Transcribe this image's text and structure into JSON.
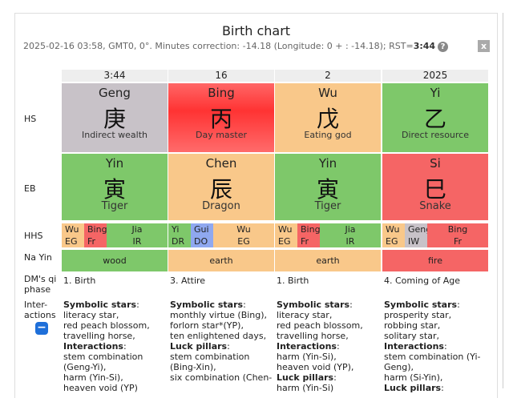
{
  "page": {
    "title": "Birth chart",
    "subtitle_prefix": "2025-02-16 03:58, GMT0, 0°. Minutes correction: -14.18 (Longitude: 0 + : -14.18); RST=",
    "rst": "3:44",
    "help_glyph": "?",
    "close_glyph": "x"
  },
  "colors": {
    "gray": "#c8c2c8",
    "red": "#f56565",
    "orange": "#f9c88a",
    "green": "#7ec86a",
    "blue": "#8fa8f0",
    "button_blue": "#1e6fd9"
  },
  "row_labels": {
    "hs": "HS",
    "eb": "EB",
    "hhs": "HHS",
    "na_yin": "Na Yin",
    "qi_phase_1": "DM's qi",
    "qi_phase_2": "phase",
    "interactions_1": "Inter-",
    "interactions_2": "actions"
  },
  "columns": [
    {
      "header": "3:44",
      "hs": {
        "pinyin": "Geng",
        "glyph": "庚",
        "role": "Indirect wealth",
        "color": "gray"
      },
      "eb": {
        "pinyin": "Yin",
        "glyph": "寅",
        "animal": "Tiger",
        "color": "green"
      },
      "hhs": [
        {
          "stem": "Wu",
          "god": "EG",
          "color": "orange"
        },
        {
          "stem": "Bing",
          "god": "Fr",
          "color": "red"
        },
        {
          "stem": "Jia",
          "god": "IR",
          "color": "green"
        }
      ],
      "na_yin": {
        "label": "wood",
        "color": "green"
      },
      "qi_phase": "1. Birth",
      "text": [
        [
          "Symbolic stars",
          ":"
        ],
        [
          "literacy star,"
        ],
        [
          "red peach blossom,"
        ],
        [
          "travelling horse,"
        ],
        [
          "Interactions",
          ":"
        ],
        [
          "stem combination"
        ],
        [
          "(Geng-Yi),"
        ],
        [
          "harm (Yin-Si),"
        ],
        [
          "heaven void (YP)"
        ]
      ]
    },
    {
      "header": "16",
      "hs": {
        "pinyin": "Bing",
        "glyph": "丙",
        "role": "Day master",
        "color": "red"
      },
      "eb": {
        "pinyin": "Chen",
        "glyph": "辰",
        "animal": "Dragon",
        "color": "orange"
      },
      "hhs": [
        {
          "stem": "Yi",
          "god": "DR",
          "color": "green"
        },
        {
          "stem": "Gui",
          "god": "DO",
          "color": "blue"
        },
        {
          "stem": "Wu",
          "god": "EG",
          "color": "orange"
        }
      ],
      "na_yin": {
        "label": "earth",
        "color": "orange"
      },
      "qi_phase": "3. Attire",
      "text": [
        [
          "Symbolic stars",
          ":"
        ],
        [
          "monthly virtue (Bing),"
        ],
        [
          "forlorn star*(YP),"
        ],
        [
          "ten enlightened days,"
        ],
        [
          "Luck pillars",
          ":"
        ],
        [
          "stem combination"
        ],
        [
          "(Bing-Xin),"
        ],
        [
          "six combination (Chen-"
        ]
      ]
    },
    {
      "header": "2",
      "hs": {
        "pinyin": "Wu",
        "glyph": "戊",
        "role": "Eating god",
        "color": "orange"
      },
      "eb": {
        "pinyin": "Yin",
        "glyph": "寅",
        "animal": "Tiger",
        "color": "green"
      },
      "hhs": [
        {
          "stem": "Wu",
          "god": "EG",
          "color": "orange"
        },
        {
          "stem": "Bing",
          "god": "Fr",
          "color": "red"
        },
        {
          "stem": "Jia",
          "god": "IR",
          "color": "green"
        }
      ],
      "na_yin": {
        "label": "earth",
        "color": "orange"
      },
      "qi_phase": "1. Birth",
      "text": [
        [
          "Symbolic stars",
          ":"
        ],
        [
          "literacy star,"
        ],
        [
          "red peach blossom,"
        ],
        [
          "travelling horse,"
        ],
        [
          "Interactions",
          ":"
        ],
        [
          "harm (Yin-Si),"
        ],
        [
          "heaven void (YP),"
        ],
        [
          "Luck pillars",
          ":"
        ],
        [
          "harm (Yin-Si)"
        ]
      ]
    },
    {
      "header": "2025",
      "hs": {
        "pinyin": "Yi",
        "glyph": "乙",
        "role": "Direct resource",
        "color": "green"
      },
      "eb": {
        "pinyin": "Si",
        "glyph": "巳",
        "animal": "Snake",
        "color": "red"
      },
      "hhs": [
        {
          "stem": "Wu",
          "god": "EG",
          "color": "orange"
        },
        {
          "stem": "Geng",
          "god": "IW",
          "color": "gray"
        },
        {
          "stem": "Bing",
          "god": "Fr",
          "color": "red"
        }
      ],
      "na_yin": {
        "label": "fire",
        "color": "red"
      },
      "qi_phase": "4. Coming of Age",
      "text": [
        [
          "Symbolic stars",
          ":"
        ],
        [
          "prosperity star,"
        ],
        [
          "robbing star,"
        ],
        [
          "solitary star,"
        ],
        [
          "Interactions",
          ":"
        ],
        [
          "stem combination (Yi-"
        ],
        [
          "Geng),"
        ],
        [
          "harm (Si-Yin),"
        ],
        [
          "Luck pillars",
          ":"
        ]
      ]
    }
  ],
  "toggle": {
    "glyph": "−"
  }
}
